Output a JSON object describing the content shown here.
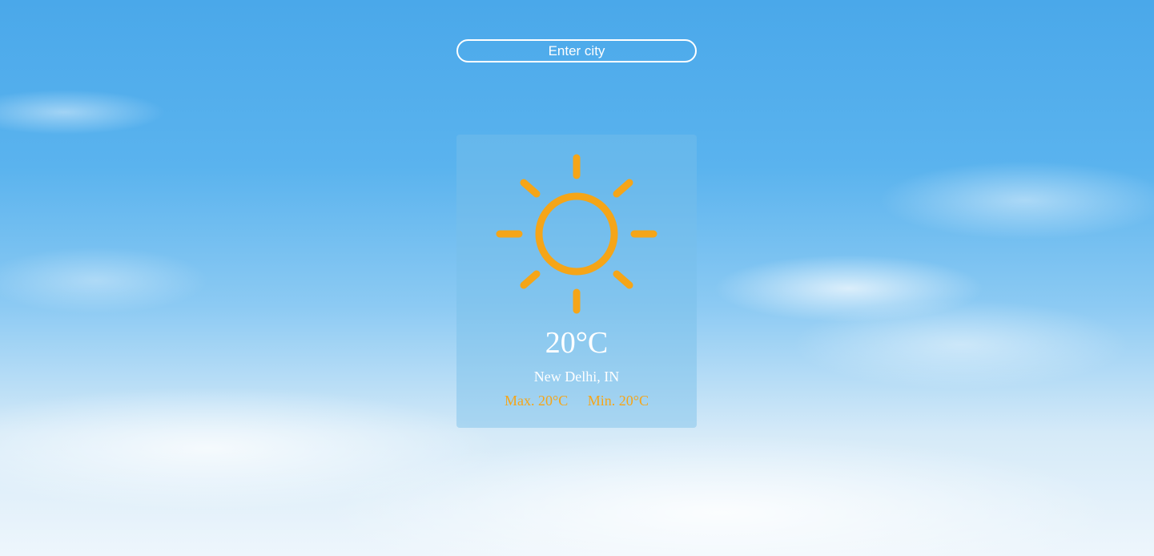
{
  "search": {
    "placeholder": "Enter city",
    "value": ""
  },
  "weather": {
    "icon": "sun-icon",
    "icon_color": "#f5a518",
    "temperature": "20°C",
    "location": "New Delhi, IN",
    "max": "Max. 20°C",
    "min": "Min. 20°C"
  }
}
